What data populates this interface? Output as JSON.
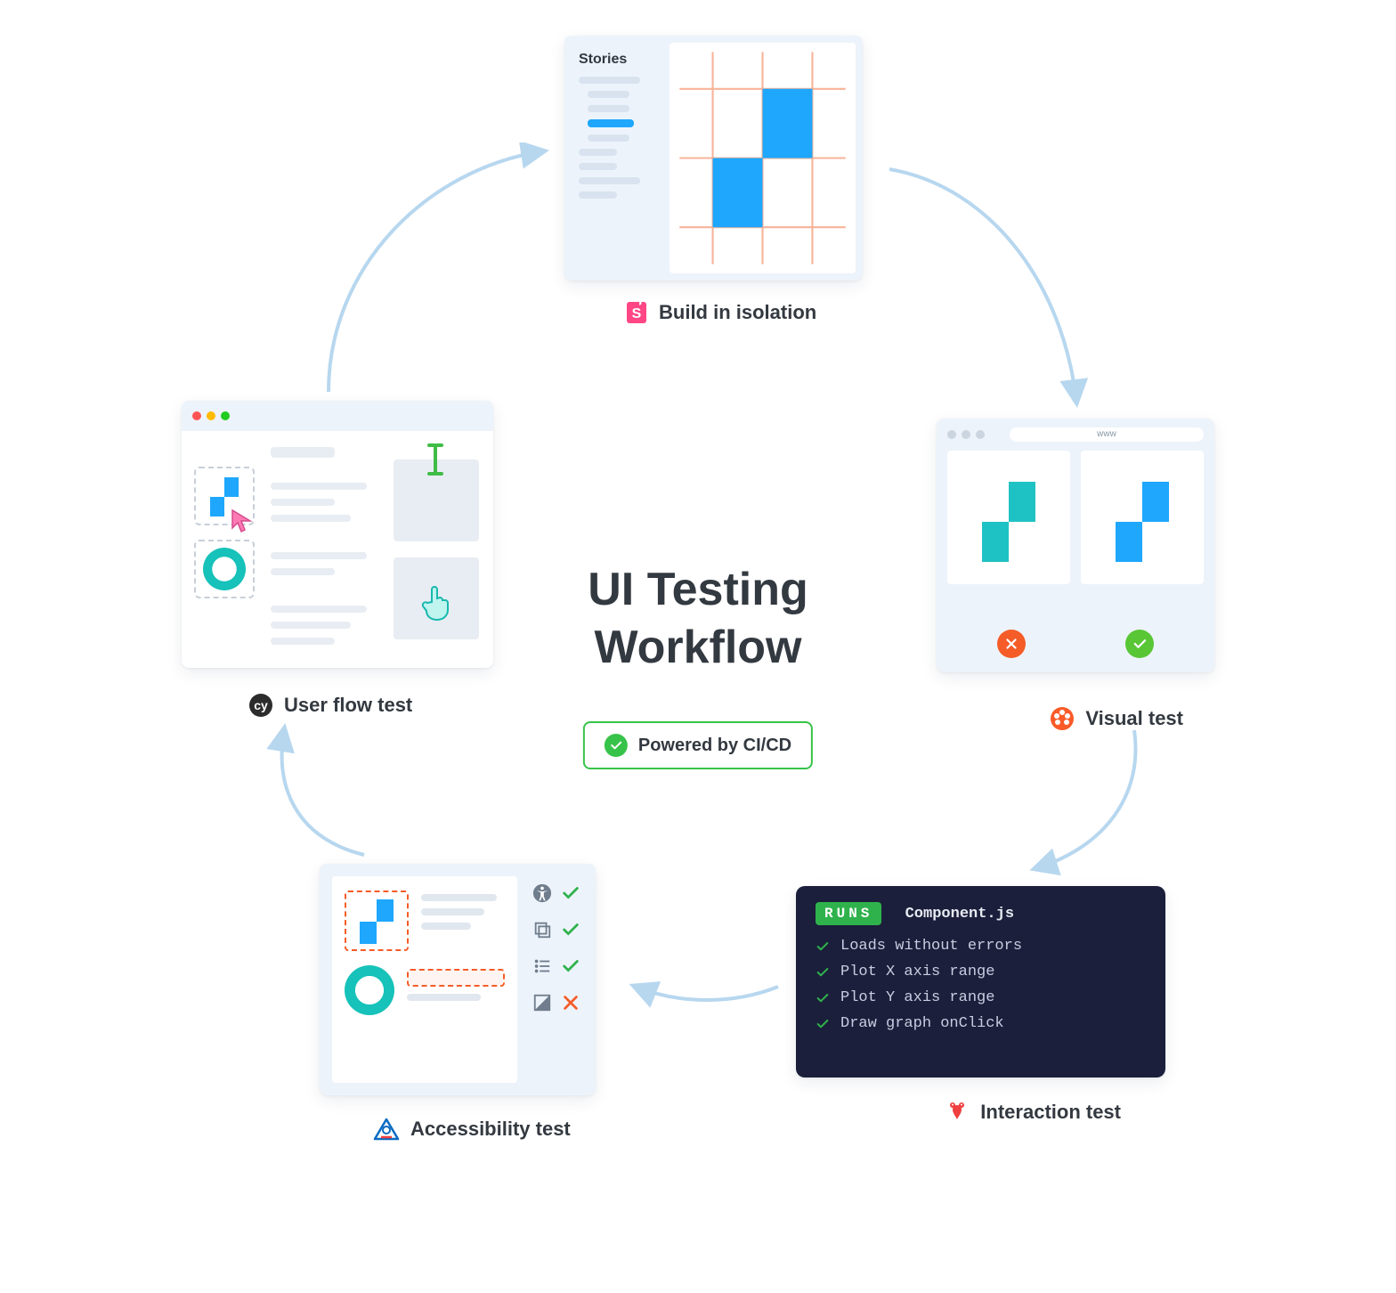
{
  "center": {
    "title_line1": "UI Testing",
    "title_line2": "Workflow",
    "ci_label": "Powered by CI/CD"
  },
  "steps": {
    "isolation": {
      "label": "Build in isolation",
      "panel_title": "Stories",
      "icon": "storybook-icon"
    },
    "visual": {
      "label": "Visual test",
      "addr": "www",
      "icon": "chromatic-icon",
      "results": [
        "fail",
        "pass"
      ]
    },
    "interaction": {
      "label": "Interaction test",
      "runs_badge": "RUNS",
      "file": "Component.js",
      "icon": "testing-library-icon",
      "checks": [
        "Loads without errors",
        "Plot X axis range",
        "Plot Y axis range",
        "Draw graph onClick"
      ]
    },
    "a11y": {
      "label": "Accessibility test",
      "icon": "axe-icon",
      "results": [
        "pass",
        "pass",
        "pass",
        "fail"
      ]
    },
    "uflow": {
      "label": "User flow test",
      "icon": "cypress-icon"
    }
  }
}
